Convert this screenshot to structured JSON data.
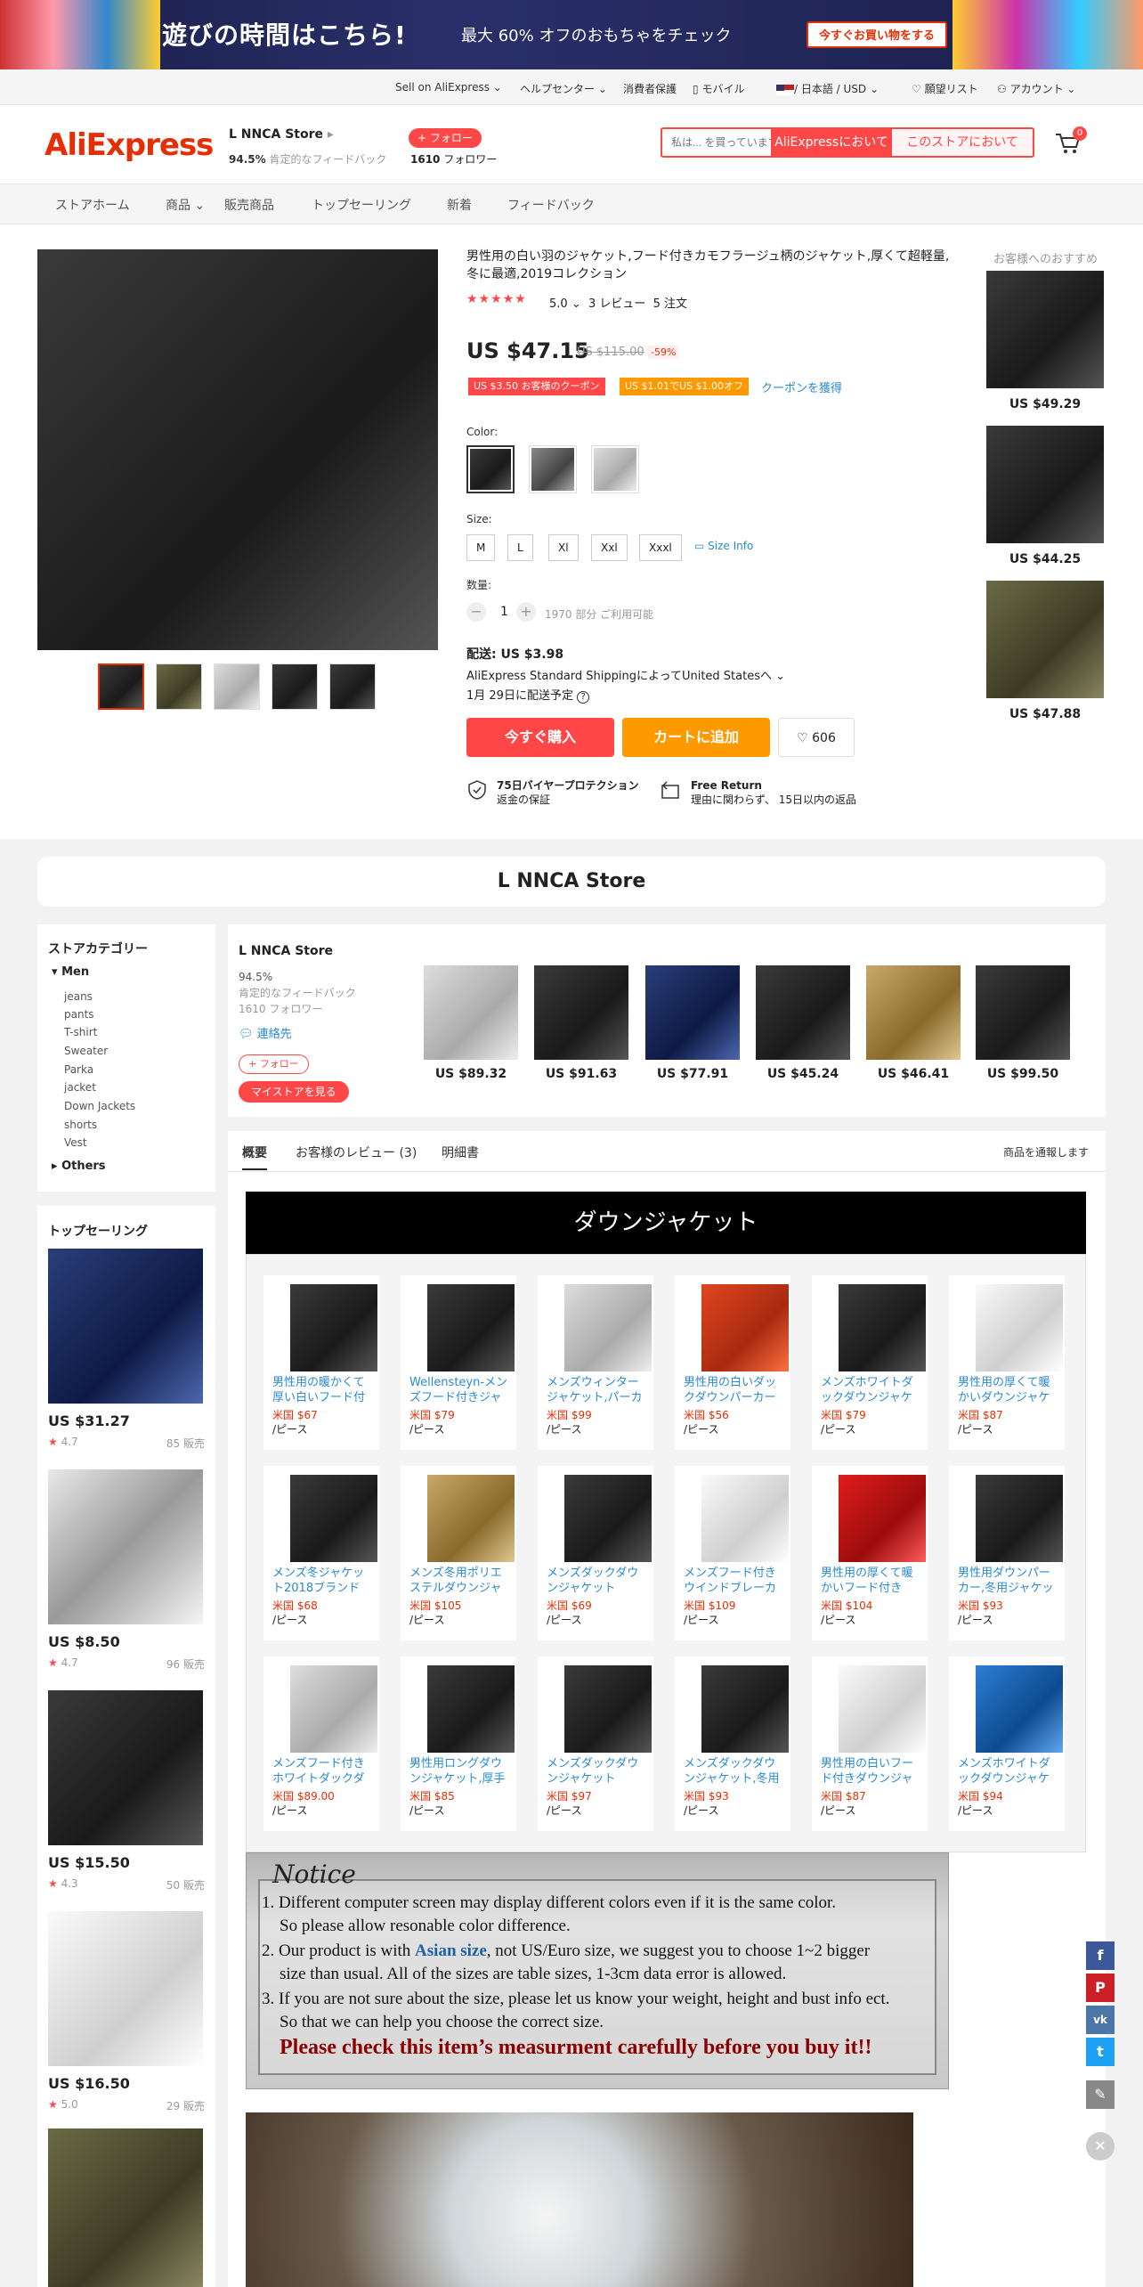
{
  "banner": {
    "title": "遊びの時間はこちら!",
    "subtitle": "最大 60% オフのおもちゃをチェック",
    "button": "今すぐお買い物をする"
  },
  "toolbar": {
    "sell": "Sell on AliExpress",
    "help": "ヘルプセンター",
    "protect": "消費者保護",
    "mobile": "モバイル",
    "lang": "/ 日本語 / USD",
    "wishlist": "願望リスト",
    "account": "アカウント"
  },
  "header": {
    "logo": "AliExpress",
    "store_name": "L NNCA Store",
    "rating_pct": "94.5%",
    "rating_label": "肯定的なフィードバック",
    "follow": "+ フォロー",
    "followers_num": "1610",
    "followers_label": "フォロワー",
    "search_placeholder": "私は... を買っています",
    "search_all": "AliExpressにおいて",
    "search_store": "このストアにおいて",
    "cart_count": "0"
  },
  "nav": [
    "ストアホーム",
    "商品",
    "販売商品",
    "トップセーリング",
    "新着",
    "フィードバック"
  ],
  "product": {
    "title": "男性用の白い羽のジャケット,フード付きカモフラージュ柄のジャケット,厚くて超軽量,冬に最適,2019コレクション",
    "rating": "5.0",
    "reviews": "3 レビュー",
    "orders": "5 注文",
    "price": "US $47.15",
    "old_price": "US $115.00",
    "discount": "-59%",
    "coupon1": "US $3.50 お客様のクーポン",
    "coupon2": "US $1.01でUS $1.00オフ",
    "get_coupon": "クーポンを獲得",
    "color_label": "Color:",
    "size_label": "Size:",
    "sizes": [
      "M",
      "L",
      "Xl",
      "Xxl",
      "Xxxl"
    ],
    "size_info": "Size Info",
    "qty_label": "数量:",
    "qty": "1",
    "available": "1970 部分 ご利用可能",
    "ship_price": "配送: US $3.98",
    "ship_method": "AliExpress Standard ShippingによってUnited Statesへ",
    "ship_date": "1月 29日に配送予定",
    "buy": "今すぐ購入",
    "add_cart": "カートに追加",
    "wish_count": "606",
    "g1_title": "75日バイヤープロテクション",
    "g1_sub": "返金の保証",
    "g2_title": "Free Return",
    "g2_sub": "理由に関わらず、 15日以内の返品"
  },
  "recommend": {
    "title": "お客様へのおすすめ",
    "prices": [
      "US $49.29",
      "US $44.25",
      "US $47.88"
    ]
  },
  "store_banner": "L NNCA Store",
  "categories": {
    "title": "ストアカテゴリー",
    "men": "Men",
    "items": [
      "jeans",
      "pants",
      "T-shirt",
      "Sweater",
      "Parka",
      "jacket",
      "Down Jackets",
      "shorts",
      "Vest"
    ],
    "others": "Others"
  },
  "storeinfo": {
    "name": "L NNCA Store",
    "rate": "94.5%",
    "rate_label": "肯定的なフィードバック",
    "followers": "1610 フォロワー",
    "contact": "連絡先",
    "follow": "+ フォロー",
    "mystore": "マイストアを見る",
    "prices": [
      "US $89.32",
      "US $91.63",
      "US $77.91",
      "US $45.24",
      "US $46.41",
      "US $99.50"
    ]
  },
  "tabs": {
    "overview": "概要",
    "reviews": "お客様のレビュー (3)",
    "specs": "明細書",
    "report": "商品を通報します"
  },
  "topselling": {
    "title": "トップセーリング",
    "items": [
      {
        "price": "US $31.27",
        "rate": "4.7",
        "sold": "85 販売"
      },
      {
        "price": "US $8.50",
        "rate": "4.7",
        "sold": "96 販売"
      },
      {
        "price": "US $15.50",
        "rate": "4.3",
        "sold": "50 販売"
      },
      {
        "price": "US $16.50",
        "rate": "5.0",
        "sold": "29 販売"
      }
    ]
  },
  "desc": {
    "title": "ダウンジャケット",
    "unit": "/ピース",
    "grid": [
      {
        "name": "男性用の暖かくて厚い白いフード付き",
        "price": "米国 $67"
      },
      {
        "name": "Wellensteyn-メンズフード付きジャケット",
        "price": "米国 $79"
      },
      {
        "name": "メンズウィンタージャケット,パーカー",
        "price": "米国 $99"
      },
      {
        "name": "男性用の白いダックダウンパーカー",
        "price": "米国 $56"
      },
      {
        "name": "メンズホワイトダックダウンジャケット",
        "price": "米国 $79"
      },
      {
        "name": "男性用の厚くて暖かいダウンジャケット",
        "price": "米国 $87"
      },
      {
        "name": "メンズ冬ジャケット2018ブランド",
        "price": "米国 $68"
      },
      {
        "name": "メンズ冬用ポリエステルダウンジャケット",
        "price": "米国 $105"
      },
      {
        "name": "メンズダックダウンジャケット",
        "price": "米国 $69"
      },
      {
        "name": "メンズフード付きウインドブレーカー",
        "price": "米国 $109"
      },
      {
        "name": "男性用の厚くて暖かいフード付き",
        "price": "米国 $104"
      },
      {
        "name": "男性用ダウンパーカー,冬用ジャケット",
        "price": "米国 $93"
      },
      {
        "name": "メンズフード付きホワイトダックダウン",
        "price": "米国 $89.00"
      },
      {
        "name": "男性用ロングダウンジャケット,厚手",
        "price": "米国 $85"
      },
      {
        "name": "メンズダックダウンジャケット",
        "price": "米国 $97"
      },
      {
        "name": "メンズダックダウンジャケット,冬用",
        "price": "米国 $93"
      },
      {
        "name": "男性用の白いフード付きダウンジャケット",
        "price": "米国 $87"
      },
      {
        "name": "メンズホワイトダックダウンジャケット",
        "price": "米国 $94"
      }
    ]
  },
  "notice": {
    "title": "Notice",
    "l1": "1. Different computer screen may display different colors even if it is the same color.",
    "l1b": "So please allow resonable color difference.",
    "l2a": "2. Our product is with ",
    "l2b": "Asian size",
    "l2c": ", not US/Euro size, we suggest you to choose 1~2 bigger",
    "l2d": "size than usual. All of the sizes are table sizes, 1-3cm data error is allowed.",
    "l3": "3. If you are not sure about the size, please let us know your weight, height and bust info ect.",
    "l3b": "So that we can help you choose the correct size.",
    "warn": "Please check this item’s measurment carefully before you buy it!!"
  },
  "social": {
    "fb": "f",
    "pin": "P",
    "vk": "vk",
    "tw": "t"
  }
}
